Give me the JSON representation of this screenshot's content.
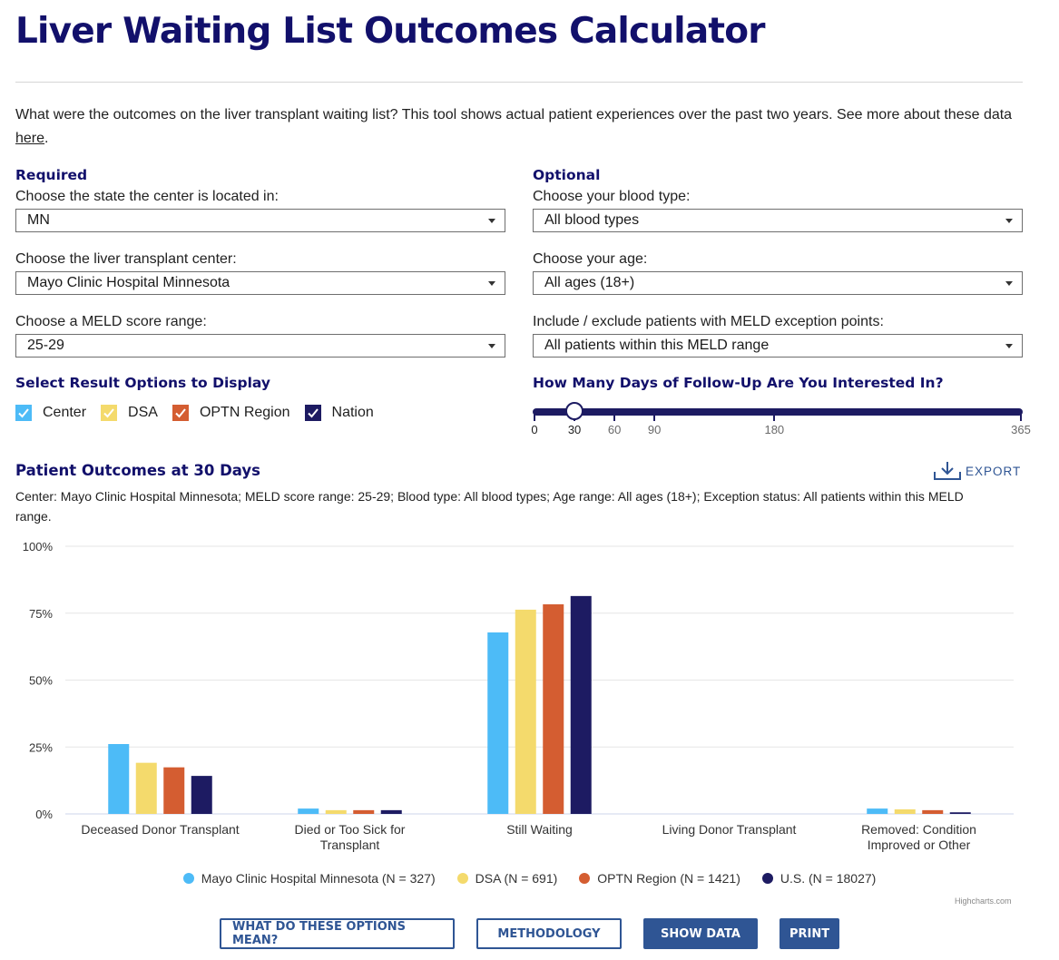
{
  "header": {
    "title": "Liver Waiting List Outcomes Calculator",
    "intro_text": "What were the outcomes on the liver transplant waiting list? This tool shows actual patient experiences over the past two years. See more about these data ",
    "intro_link": "here",
    "intro_end": "."
  },
  "required": {
    "heading": "Required",
    "state_label": "Choose the state the center is located in:",
    "state_value": "MN",
    "center_label": "Choose the liver transplant center:",
    "center_value": "Mayo Clinic Hospital Minnesota",
    "meld_label": "Choose a MELD score range:",
    "meld_value": "25-29"
  },
  "optional": {
    "heading": "Optional",
    "blood_label": "Choose your blood type:",
    "blood_value": "All blood types",
    "age_label": "Choose your age:",
    "age_value": "All ages (18+)",
    "exception_label": "Include / exclude patients with MELD exception points:",
    "exception_value": "All patients within this MELD range"
  },
  "display_options": {
    "heading": "Select Result Options to Display",
    "items": [
      {
        "label": "Center",
        "checked": true,
        "color": "#4dbbf7"
      },
      {
        "label": "DSA",
        "checked": true,
        "color": "#f4da6c"
      },
      {
        "label": "OPTN Region",
        "checked": true,
        "color": "#d45d31"
      },
      {
        "label": "Nation",
        "checked": true,
        "color": "#1d1b62"
      }
    ]
  },
  "followup": {
    "heading": "How Many Days of Follow-Up Are You Interested In?",
    "min": 0,
    "max": 365,
    "value": 30,
    "ticks": [
      "0",
      "30",
      "60",
      "90",
      "180",
      "365"
    ]
  },
  "chart_header": {
    "title": "Patient Outcomes at 30 Days",
    "export_label": "EXPORT",
    "subtitle": "Center: Mayo Clinic Hospital Minnesota; MELD score range: 25-29; Blood type: All blood types; Age range: All ages (18+); Exception status: All patients within this MELD range."
  },
  "chart_data": {
    "type": "bar",
    "title": "Patient Outcomes at 30 Days",
    "xlabel": "",
    "ylabel": "",
    "ylim": [
      0,
      100
    ],
    "yticks": [
      "0%",
      "25%",
      "50%",
      "75%",
      "100%"
    ],
    "ytick_values": [
      0,
      25,
      50,
      75,
      100
    ],
    "grid": true,
    "legend_position": "bottom-center",
    "categories": [
      [
        "Deceased Donor Transplant"
      ],
      [
        "Died or Too Sick for",
        "Transplant"
      ],
      [
        "Still Waiting"
      ],
      [
        "Living Donor Transplant"
      ],
      [
        "Removed: Condition",
        "Improved or Other"
      ]
    ],
    "series": [
      {
        "name": "Mayo Clinic Hospital Minnesota (N = 327)",
        "color": "#4dbbf7",
        "values": [
          26.1,
          2.0,
          67.8,
          0,
          2.0
        ]
      },
      {
        "name": "DSA (N = 691)",
        "color": "#f4da6c",
        "values": [
          19.1,
          1.4,
          76.3,
          0,
          1.7
        ]
      },
      {
        "name": "OPTN Region (N = 1421)",
        "color": "#d45d31",
        "values": [
          17.4,
          1.4,
          78.3,
          0,
          1.4
        ]
      },
      {
        "name": "U.S. (N = 18027)",
        "color": "#1d1b62",
        "values": [
          14.2,
          1.4,
          81.4,
          0,
          0.6
        ]
      }
    ],
    "credits": "Highcharts.com"
  },
  "buttons": {
    "options_meaning": "WHAT DO THESE OPTIONS MEAN?",
    "methodology": "METHODOLOGY",
    "show_data": "SHOW DATA",
    "print": "PRINT"
  }
}
